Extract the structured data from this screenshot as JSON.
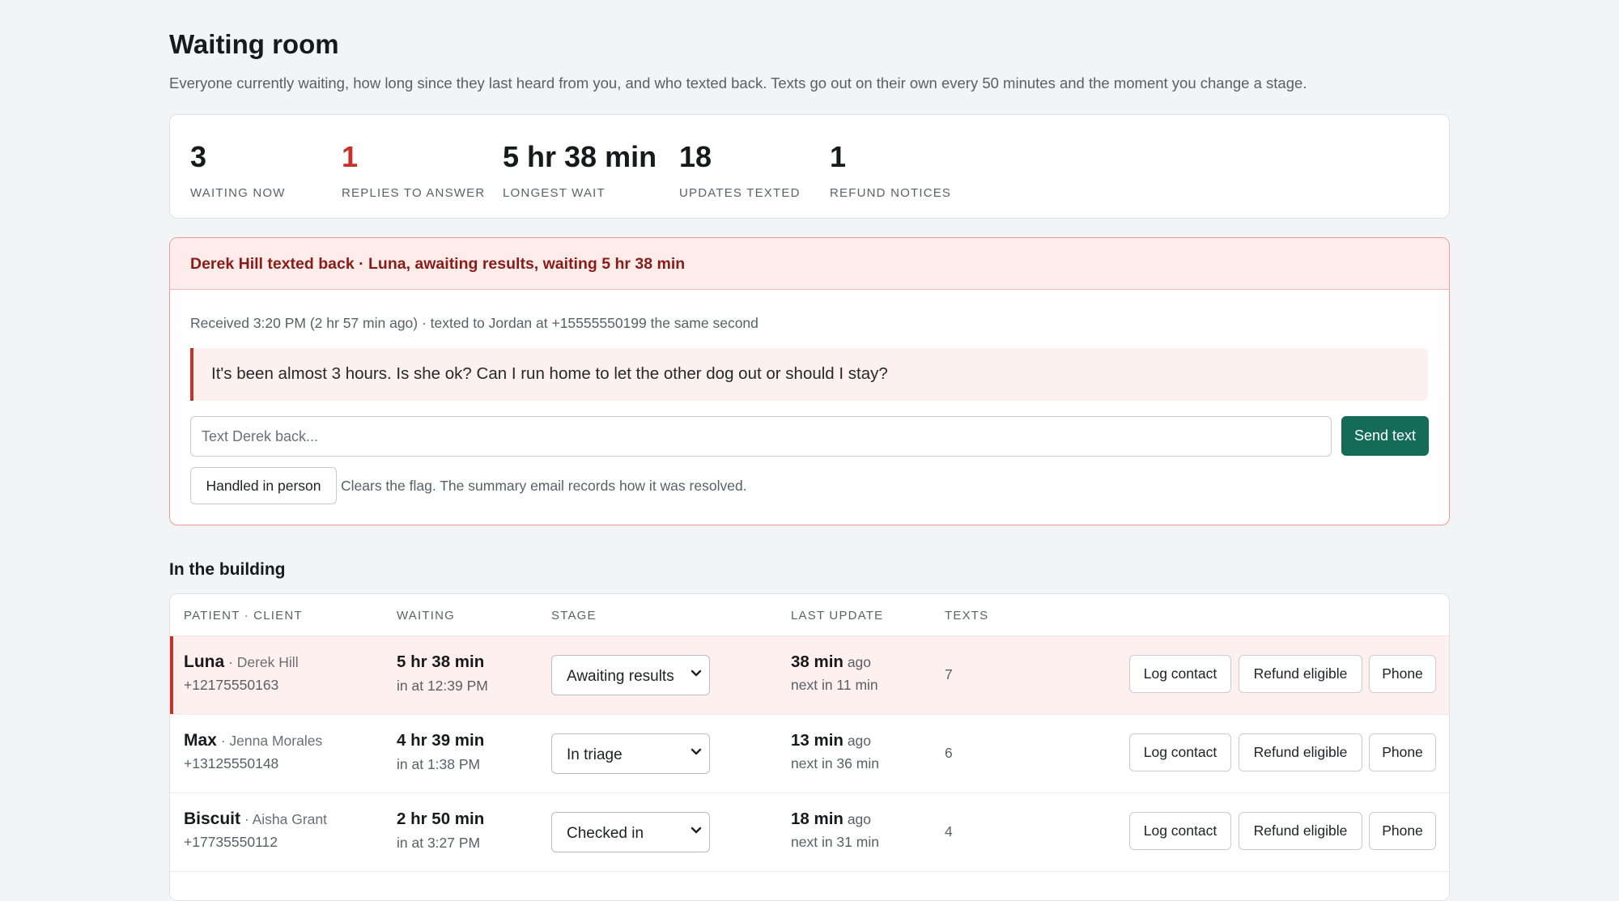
{
  "header": {
    "title": "Waiting room",
    "subtitle": "Everyone currently waiting, how long since they last heard from you, and who texted back. Texts go out on their own every 50 minutes and the moment you change a stage."
  },
  "stats": [
    {
      "value": "3",
      "label": "Waiting now"
    },
    {
      "value": "1",
      "label": "Replies to answer"
    },
    {
      "value": "5 hr 38 min",
      "label": "Longest wait"
    },
    {
      "value": "18",
      "label": "Updates texted"
    },
    {
      "value": "1",
      "label": "Refund notices"
    }
  ],
  "alert": {
    "title": "Derek Hill texted back · Luna, awaiting results, waiting 5 hr 38 min",
    "received": "Received 3:20 PM (2 hr 57 min ago) · texted to Jordan at +15555550199 the same second",
    "message": "It's been almost 3 hours. Is she ok? Can I run home to let the other dog out or should I stay?",
    "reply_placeholder": "Text Derek back...",
    "send_label": "Send text",
    "handled_label": "Handled in person",
    "handled_note": "Clears the flag. The summary email records how it was resolved."
  },
  "building": {
    "title": "In the building",
    "columns": [
      "Patient · Client",
      "Waiting",
      "Stage",
      "Last update",
      "Texts"
    ],
    "rows": [
      {
        "patient": "Luna",
        "sep": " · ",
        "client": "Derek Hill",
        "phone": "+12175550163",
        "waiting": "5 hr 38 min",
        "in_at": "in at 12:39 PM",
        "stage": "Awaiting results",
        "last": "38 min",
        "ago": " ago",
        "next": "next in 11 min",
        "texts": "7",
        "log": "Log contact",
        "refund": "Refund eligible",
        "call": "Phone"
      },
      {
        "patient": "Max",
        "sep": " · ",
        "client": "Jenna Morales",
        "phone": "+13125550148",
        "waiting": "4 hr 39 min",
        "in_at": "in at 1:38 PM",
        "stage": "In triage",
        "last": "13 min",
        "ago": " ago",
        "next": "next in 36 min",
        "texts": "6",
        "log": "Log contact",
        "refund": "Refund eligible",
        "call": "Phone"
      },
      {
        "patient": "Biscuit",
        "sep": " · ",
        "client": "Aisha Grant",
        "phone": "+17735550112",
        "waiting": "2 hr 50 min",
        "in_at": "in at 3:27 PM",
        "stage": "Checked in",
        "last": "18 min",
        "ago": " ago",
        "next": "next in 31 min",
        "texts": "4",
        "log": "Log contact",
        "refund": "Refund eligible",
        "call": "Phone"
      }
    ]
  },
  "colors": {
    "alert": "#c8302a",
    "primary": "#136b58",
    "alert_bg": "#fdecea"
  },
  "icons": {
    "stage_select": "chevron-down-icon"
  }
}
